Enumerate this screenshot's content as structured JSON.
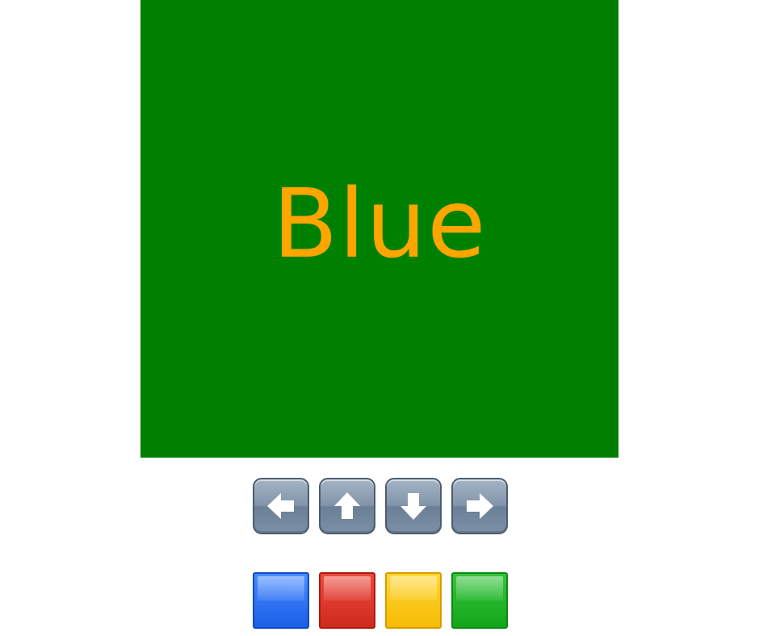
{
  "game": {
    "word": "Blue",
    "word_color": "#ffa500",
    "panel_color": "#008000"
  },
  "controls": {
    "arrows": [
      {
        "direction": "left",
        "icon": "left-arrow-icon"
      },
      {
        "direction": "up",
        "icon": "up-arrow-icon"
      },
      {
        "direction": "down",
        "icon": "down-arrow-icon"
      },
      {
        "direction": "right",
        "icon": "right-arrow-icon"
      }
    ],
    "color_buttons": [
      {
        "color": "blue",
        "hex": "#1a5fe8"
      },
      {
        "color": "red",
        "hex": "#cf2a1e"
      },
      {
        "color": "yellow",
        "hex": "#f5bb05"
      },
      {
        "color": "green",
        "hex": "#13a61b"
      }
    ]
  }
}
